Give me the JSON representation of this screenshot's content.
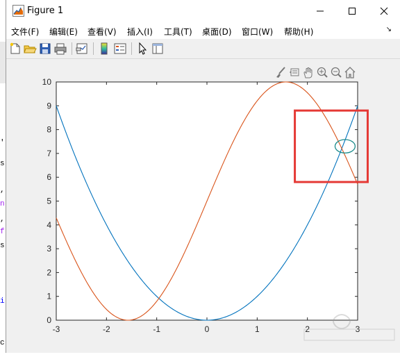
{
  "window": {
    "title": "Figure 1"
  },
  "menu": {
    "items": [
      "文件(F)",
      "编辑(E)",
      "查看(V)",
      "插入(I)",
      "工具(T)",
      "桌面(D)",
      "窗口(W)",
      "帮助(H)"
    ]
  },
  "toolbar": {
    "buttons": [
      "new-figure",
      "open-file",
      "save",
      "print",
      "link-plot",
      "insert-colorbar",
      "insert-legend",
      "edit-plot",
      "property-inspector"
    ]
  },
  "axes_toolbar": {
    "buttons": [
      "brush",
      "data-tips",
      "pan",
      "zoom-in",
      "zoom-out",
      "restore-view"
    ]
  },
  "chart_data": {
    "type": "line",
    "xlim": [
      -3,
      3
    ],
    "ylim": [
      0,
      10
    ],
    "x_ticks": [
      "-3",
      "-2",
      "-1",
      "0",
      "1",
      "2",
      "3"
    ],
    "y_ticks": [
      "0",
      "1",
      "2",
      "3",
      "4",
      "5",
      "6",
      "7",
      "8",
      "9",
      "10"
    ],
    "grid": false,
    "series": [
      {
        "color": "#0072BD",
        "formula_samples": {
          "x": [
            -3,
            -2,
            -1,
            0,
            1,
            2,
            3
          ],
          "y": [
            9,
            4,
            1,
            0,
            1,
            4,
            9
          ]
        }
      },
      {
        "color": "#D95319",
        "formula_samples": {
          "x": [
            -3,
            -1.57,
            0,
            1.57,
            3
          ],
          "y": [
            4.29,
            0,
            5,
            10,
            5.71
          ]
        }
      }
    ],
    "annotations": [
      {
        "type": "rectangle",
        "color": "#e53935",
        "x_range": [
          1.75,
          3.2
        ],
        "y_range": [
          5.8,
          8.8
        ]
      },
      {
        "type": "ellipse",
        "color": "#1a8a8a",
        "cx": 2.75,
        "cy": 7.3,
        "rx": 0.2,
        "ry": 0.28
      }
    ]
  }
}
